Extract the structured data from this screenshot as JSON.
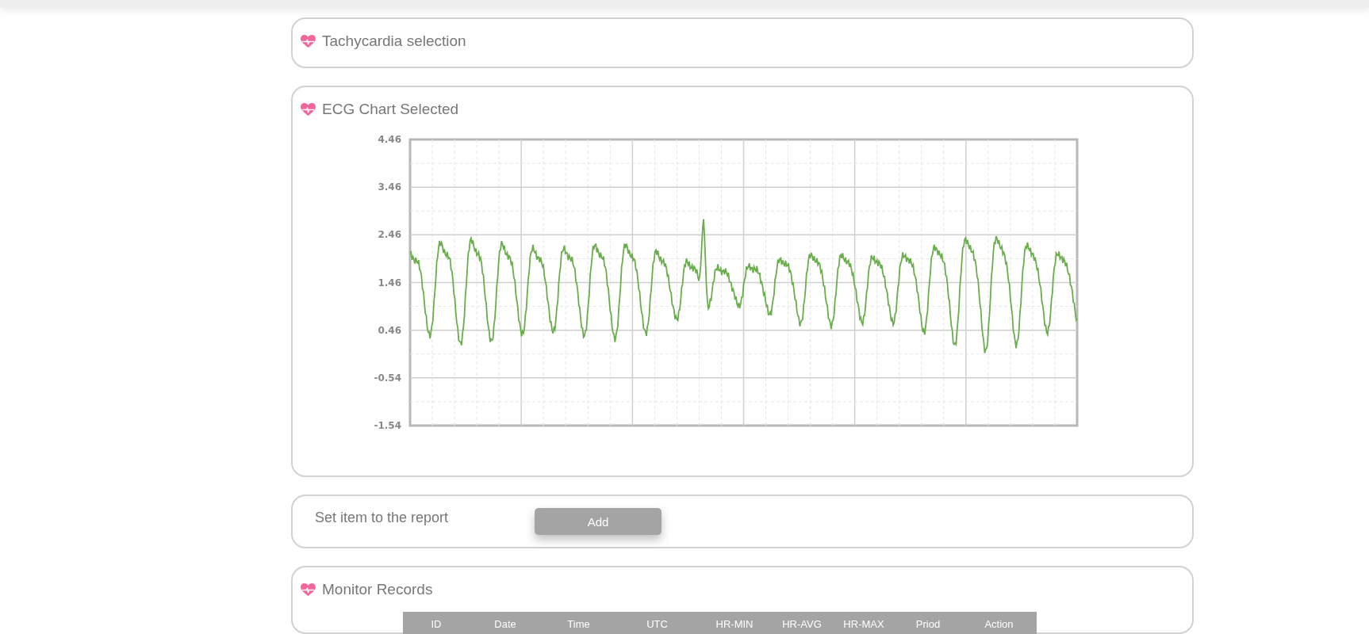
{
  "sections": [
    {
      "title": "Tachycardia selection"
    },
    {
      "title": "ECG Chart Selected",
      "y_axis_labels": [
        "4.46",
        "3.46",
        "2.46",
        "1.46",
        "0.46",
        "-0.54",
        "-1.54"
      ]
    }
  ],
  "report": {
    "label": "Set item to the report",
    "button": "Add"
  },
  "records": {
    "title": "Monitor Records",
    "columns": [
      "ID",
      "Date",
      "Time",
      "UTC",
      "HR-MIN",
      "HR-AVG",
      "HR-MAX",
      "Priod",
      "Action"
    ]
  }
}
